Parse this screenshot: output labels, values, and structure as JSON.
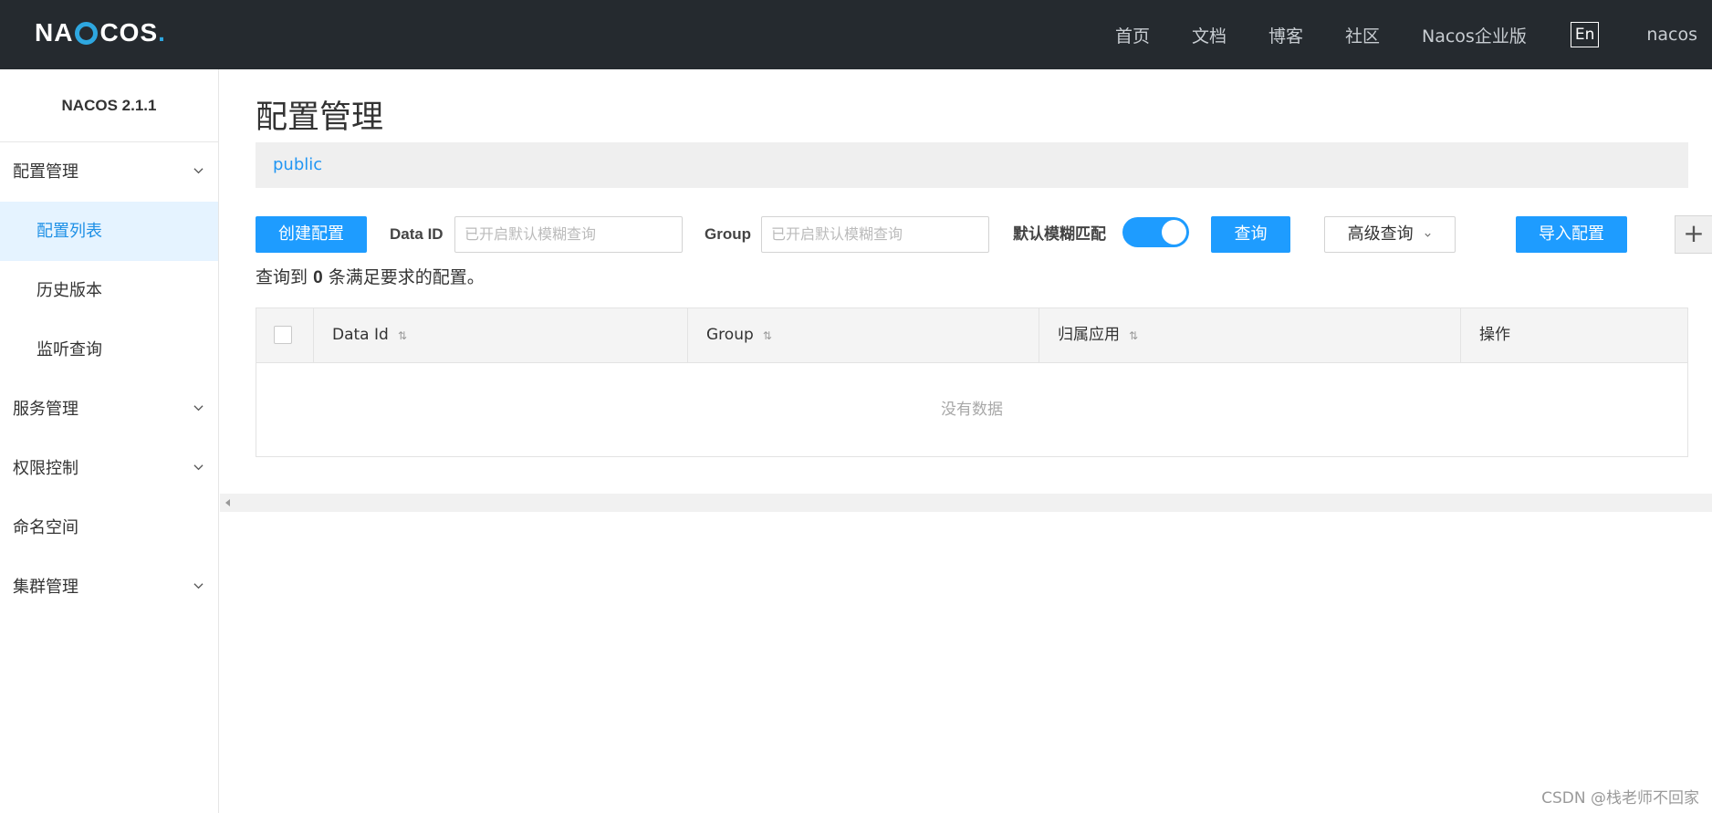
{
  "header": {
    "logo_left": "NA",
    "logo_right": "COS",
    "logo_dot": ".",
    "nav": [
      "首页",
      "文档",
      "博客",
      "社区",
      "Nacos企业版"
    ],
    "lang": "En",
    "user": "nacos"
  },
  "sidebar": {
    "version": "NACOS 2.1.1",
    "items": [
      {
        "label": "配置管理",
        "expandable": true
      },
      {
        "label": "配置列表",
        "sub": true,
        "active": true
      },
      {
        "label": "历史版本",
        "sub": true
      },
      {
        "label": "监听查询",
        "sub": true
      },
      {
        "label": "服务管理",
        "expandable": true
      },
      {
        "label": "权限控制",
        "expandable": true
      },
      {
        "label": "命名空间",
        "expandable": false
      },
      {
        "label": "集群管理",
        "expandable": true
      }
    ]
  },
  "main": {
    "title": "配置管理",
    "namespace": "public",
    "toolbar": {
      "create_label": "创建配置",
      "dataid_label": "Data ID",
      "dataid_placeholder": "已开启默认模糊查询",
      "group_label": "Group",
      "group_placeholder": "已开启默认模糊查询",
      "fuzzy_label": "默认模糊匹配",
      "fuzzy_on": true,
      "query_label": "查询",
      "advanced_label": "高级查询",
      "import_label": "导入配置",
      "plus_label": "+"
    },
    "result": {
      "prefix": "查询到",
      "count": "0",
      "suffix": "条满足要求的配置。"
    },
    "table": {
      "columns": [
        "Data Id",
        "Group",
        "归属应用",
        "操作"
      ],
      "empty_text": "没有数据"
    }
  },
  "watermark": "CSDN @栈老师不回家",
  "colors": {
    "header_bg": "#252a2f",
    "primary": "#1e9cff",
    "active_bg": "#e5f3ff",
    "link": "#2196f3"
  }
}
